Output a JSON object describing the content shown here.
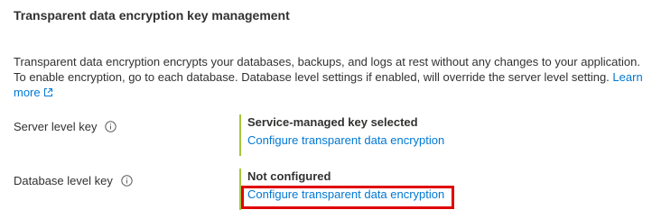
{
  "section": {
    "title": "Transparent data encryption key management"
  },
  "description": {
    "line1": "Transparent data encryption encrypts your databases, backups, and logs at rest without any changes to your application.",
    "line2_prefix": "To enable encryption, go to each database. Database level settings if enabled, will override the server level setting.",
    "learn_more_part1": "Learn",
    "learn_more_part2": "more",
    "learn_more_icon": "external-link-icon"
  },
  "server_level_key": {
    "label": "Server level key",
    "info_icon": "info-icon",
    "status": "Service-managed key selected",
    "link": "Configure transparent data encryption"
  },
  "database_level_key": {
    "label": "Database level key",
    "info_icon": "info-icon",
    "status": "Not configured",
    "link": "Configure transparent data encryption"
  },
  "colors": {
    "link": "#0078d4",
    "status_border": "#a4c639",
    "highlight": "#e00000",
    "text": "#323130"
  }
}
